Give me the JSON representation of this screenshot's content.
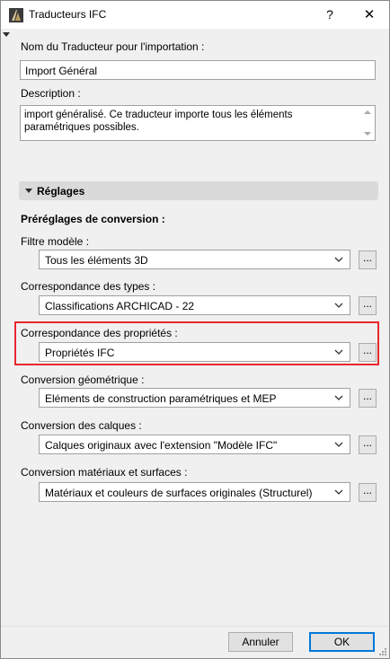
{
  "window": {
    "title": "Traducteurs IFC",
    "help_label": "?",
    "close_label": "✕"
  },
  "translator": {
    "name_label": "Nom du Traducteur pour l'importation :",
    "name_value": "Import Général",
    "description_label": "Description :",
    "description_value": "import généralisé. Ce traducteur importe tous les éléments paramétriques possibles."
  },
  "settings": {
    "section_label": "Réglages",
    "presets_label": "Préréglages de conversion :",
    "rows": [
      {
        "label": "Filtre modèle :",
        "value": "Tous les éléments 3D",
        "button": "..."
      },
      {
        "label": "Correspondance des types :",
        "value": "Classifications ARCHICAD - 22",
        "button": "..."
      },
      {
        "label": "Correspondance des propriétés :",
        "value": "Propriétés IFC",
        "button": "..."
      },
      {
        "label": "Conversion géométrique :",
        "value": "Eléments de construction paramétriques et MEP",
        "button": "..."
      },
      {
        "label": "Conversion des calques :",
        "value": "Calques originaux avec l'extension \"Modèle IFC\"",
        "button": "..."
      },
      {
        "label": "Conversion matériaux et surfaces :",
        "value": "Matériaux et couleurs de surfaces originales (Structurel)",
        "button": "..."
      }
    ]
  },
  "footer": {
    "cancel_label": "Annuler",
    "ok_label": "OK"
  },
  "colors": {
    "highlight": "#e8262d",
    "ok_border": "#0078d7"
  },
  "icons": {
    "app": "archicad-icon",
    "help": "help-icon",
    "close": "close-icon",
    "dropdown": "chevron-down-icon"
  }
}
